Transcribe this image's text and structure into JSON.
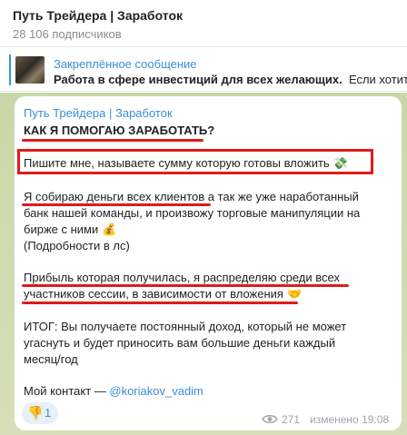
{
  "header": {
    "title": "Путь Трейдера | Заработок",
    "subscribers": "28 106 подписчиков"
  },
  "pinned": {
    "title": "Закреплённое сообщение",
    "text_bold": "Работа в сфере инвестиций для всех желающих.",
    "text_rest": "  Если хотите"
  },
  "message": {
    "author": "Путь Трейдера | Заработок",
    "heading": "КАК Я ПОМОГАЮ ЗАРАБОТАТЬ?",
    "line1": "Пишите мне, называете сумму которую готовы вложить",
    "line1_emoji": "💸",
    "line2": "Я собираю деньги всех клиентов а так же уже наработанный",
    "line3": "банк нашей команды, и произвожу торговые манипуляции на",
    "line4": "бирже с ними",
    "line4_emoji": "💰",
    "line5": "(Подробности в лс)",
    "line6": "Прибыль которая получилась, я распределяю среди всех",
    "line7": "участников сессии, в зависимости от вложения",
    "line7_emoji": "🤝",
    "line8": "ИТОГ: Вы получаете постоянный доход, который не может",
    "line9": "угаснуть и будет приносить вам большие деньги каждый",
    "line10": "месяц/год",
    "contact_label": "Мой контакт — ",
    "contact_link": "@koriakov_vadim"
  },
  "reaction": {
    "icon": "thumbs-down-icon",
    "emoji": "👎",
    "count": "1"
  },
  "meta": {
    "views": "271",
    "edited": "изменено 19:08"
  },
  "colors": {
    "accent": "#3a8fd6",
    "highlight": "#e01b1b",
    "chat_background": "#cfdcb2"
  }
}
